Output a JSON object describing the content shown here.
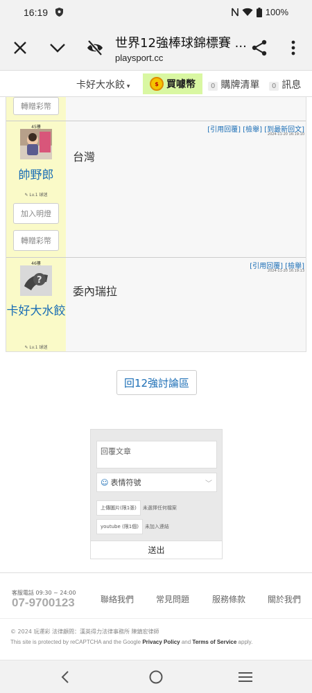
{
  "status_bar": {
    "time": "16:19",
    "battery": "100%"
  },
  "browser": {
    "title": "世界12強棒球錦標賽 ...",
    "url": "playsport.cc"
  },
  "nav": {
    "user": "卡好大水餃",
    "coin": "買噱幣",
    "purchase_badge": "0",
    "purchase_label": "購牌清單",
    "msg_badge": "0",
    "msg_label": "訊息"
  },
  "posts": {
    "prev_tip_btn": "轉贈彩幣",
    "actions_a": "[引用回覆] [檢舉] [到最新回文]",
    "actions_b": "[引用回覆] [檢舉]",
    "items": [
      {
        "floor": "45樓",
        "username": "帥野郎",
        "level": "✎ Lv.1 球迷",
        "follow_btn": "加入明燈",
        "tip_btn": "轉贈彩幣",
        "time": "2024-11-20 16:19:10",
        "content": "台灣"
      },
      {
        "floor": "46樓",
        "username": "卡好大水餃",
        "level": "✎ Lv.1 球迷",
        "time": "2024-11-20 16:19:13",
        "content": "委內瑞拉"
      }
    ]
  },
  "back_button": "回12強討論區",
  "reply": {
    "placeholder": "回覆文章",
    "emoji_label": "表情符號",
    "upload_image_btn": "上傳圖片(限1張)",
    "upload_image_status": "未選擇任何檔案",
    "youtube_btn": "youtube (限1個)",
    "youtube_status": "未加入連結",
    "submit": "送出"
  },
  "footer": {
    "hotline_label": "客服電話 09:30 ~ 24:00",
    "hotline_number": "07-9700123",
    "links": [
      "聯絡我們",
      "常見問題",
      "服務條款",
      "關於我們"
    ],
    "copyright": "© 2024 玩運彩 法律顧問：漢英得力法律事務所 陳鎮宏律師",
    "recaptcha_pre": "This site is protected by reCAPTCHA and the Google",
    "privacy": "Privacy Policy",
    "and": "and",
    "terms": "Terms of Service",
    "apply": "apply."
  },
  "icons": {
    "close": "close-icon",
    "chevron": "chevron-down-icon",
    "eye_off": "eye-off-icon",
    "share": "share-icon",
    "more": "more-vert-icon"
  }
}
